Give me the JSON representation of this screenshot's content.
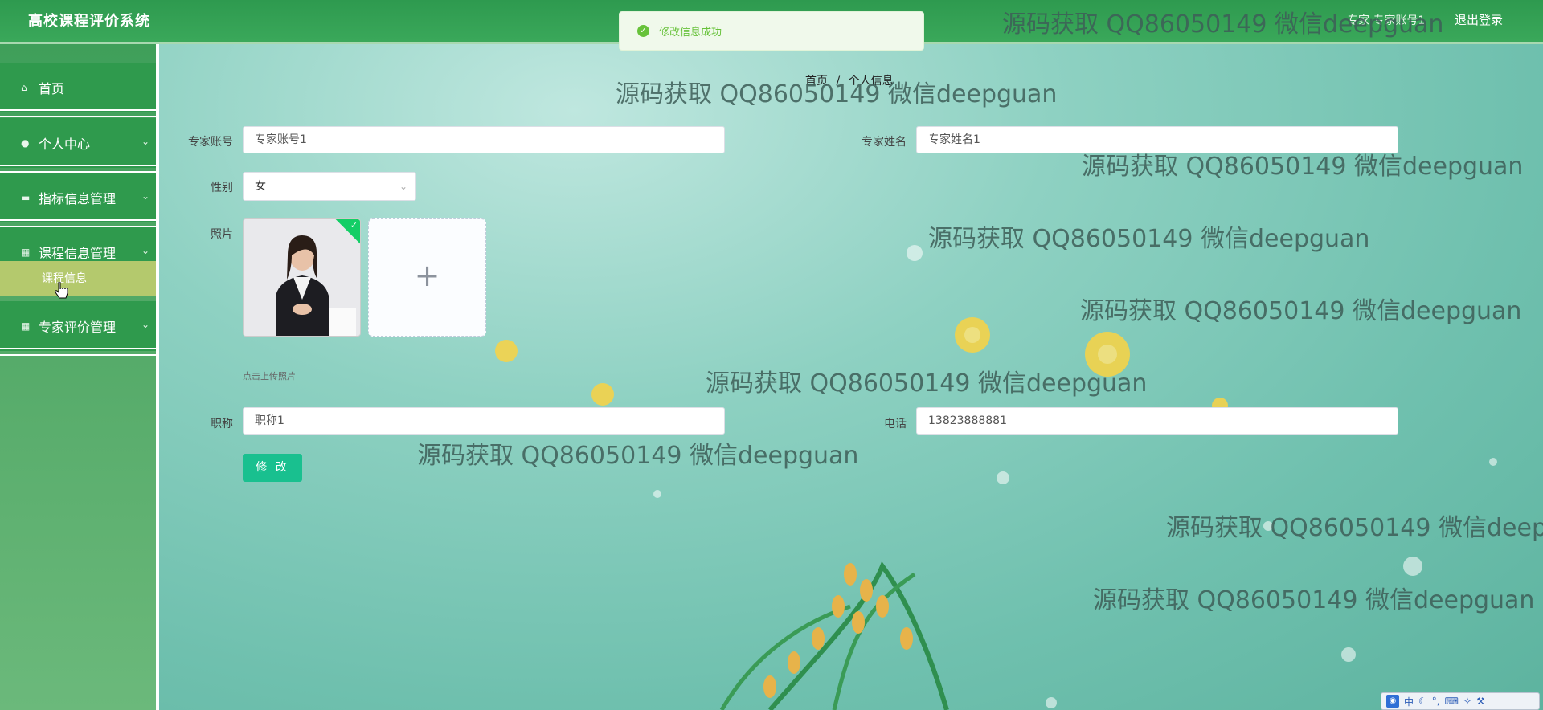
{
  "header": {
    "brand": "高校课程评价系统",
    "user": "专家 专家账号1",
    "logout": "退出登录"
  },
  "toast": {
    "message": "修改信息成功"
  },
  "sidebar": {
    "items": [
      {
        "label": "首页",
        "icon": "home-icon"
      },
      {
        "label": "个人中心",
        "icon": "user-icon"
      },
      {
        "label": "指标信息管理",
        "icon": "comment-icon"
      },
      {
        "label": "课程信息管理",
        "icon": "grid-icon"
      },
      {
        "label": "专家评价管理",
        "icon": "grid-icon"
      }
    ],
    "active_sub": "课程信息"
  },
  "breadcrumb": {
    "home": "首页",
    "current": "个人信息",
    "separator": "/"
  },
  "form": {
    "account_label": "专家账号",
    "account_value": "专家账号1",
    "name_label": "专家姓名",
    "name_value": "专家姓名1",
    "gender_label": "性别",
    "gender_value": "女",
    "photo_label": "照片",
    "photo_hint": "点击上传照片",
    "upload_plus": "+",
    "title_label": "职称",
    "title_value": "职称1",
    "phone_label": "电话",
    "phone_value": "13823888881",
    "submit_label": "修 改"
  },
  "watermark": "源码获取 QQ86050149 微信deepguan",
  "ime": {
    "mode": "中"
  }
}
